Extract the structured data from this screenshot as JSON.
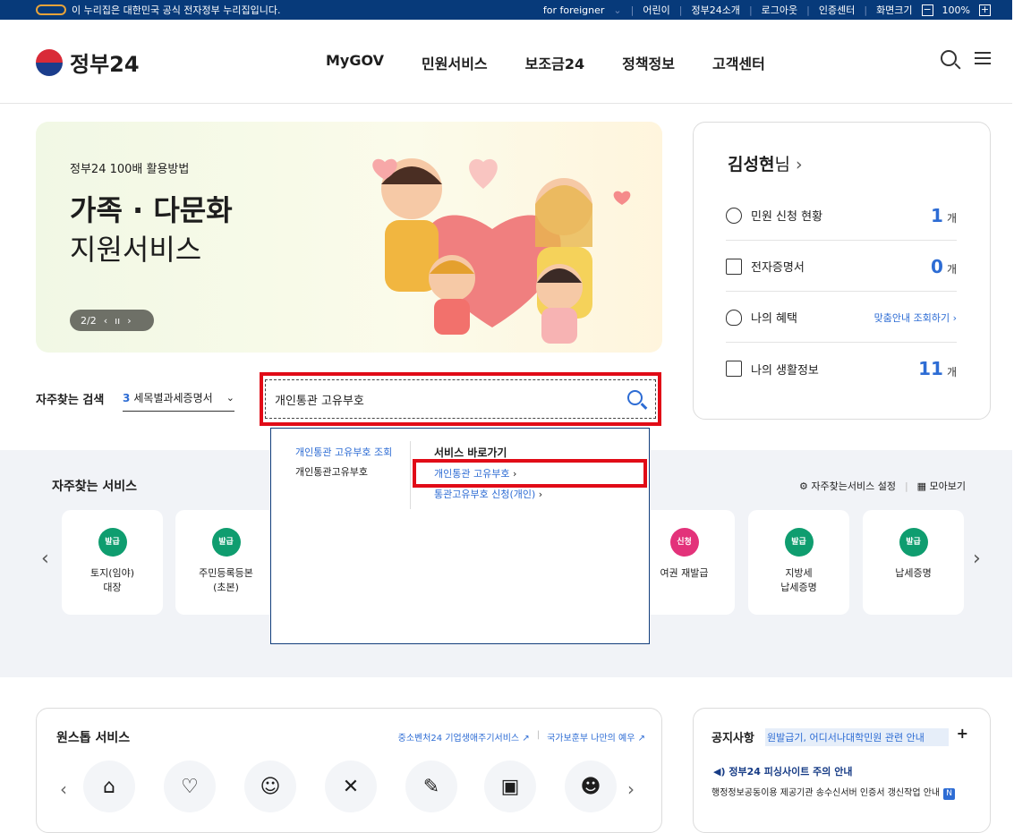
{
  "topbar": {
    "gov_notice": "이 누리집은 대한민국 공식 전자정부 누리집입니다.",
    "links": [
      "for foreigner",
      "어린이",
      "정부24소개",
      "로그아웃",
      "인증센터",
      "화면크기"
    ],
    "zoom": "100%",
    "zoom_minus": "−",
    "zoom_plus": "+"
  },
  "header": {
    "logo": "정부24",
    "nav": [
      "MyGOV",
      "민원서비스",
      "보조금24",
      "정책정보",
      "고객센터"
    ]
  },
  "banner": {
    "subtitle": "정부24 100배 활용방법",
    "title_line1": "가족 · 다문화",
    "title_line2": "지원서비스",
    "pager": "2/2"
  },
  "user": {
    "name": "김성현",
    "suffix": "님",
    "rows": [
      {
        "label": "민원 신청 현황",
        "count": "1",
        "unit": "개"
      },
      {
        "label": "전자증명서",
        "count": "0",
        "unit": "개"
      },
      {
        "label": "나의 혜택",
        "link": "맞춤안내 조회하기"
      },
      {
        "label": "나의 생활정보",
        "count": "11",
        "unit": "개"
      }
    ]
  },
  "search": {
    "label": "자주찾는 검색",
    "select_num": "3",
    "select_text": "세목별과세증명서",
    "query": "개인통관 고유부호"
  },
  "dropdown": {
    "suggest1": "개인통관 고유부호 조회",
    "suggest2": "개인통관고유부호",
    "shortcut_title": "서비스 바로가기",
    "shortcut1": "개인통관 고유부호",
    "shortcut2": "통관고유부호 신청(개인)"
  },
  "favorites": {
    "title": "자주찾는 서비스",
    "settings": "자주찾는서비스 설정",
    "view_all": "모아보기",
    "cards": [
      {
        "badge": "발급",
        "color": "#0f9d6f",
        "line1": "토지(임야)",
        "line2": "대장"
      },
      {
        "badge": "발급",
        "color": "#0f9d6f",
        "line1": "주민등록등본",
        "line2": "(초본)"
      },
      {
        "badge": "신청",
        "color": "#e3327a",
        "line1": "여권 재발급",
        "line2": ""
      },
      {
        "badge": "발급",
        "color": "#0f9d6f",
        "line1": "지방세",
        "line2": "납세증명"
      },
      {
        "badge": "발급",
        "color": "#0f9d6f",
        "line1": "납세증명",
        "line2": ""
      }
    ]
  },
  "onestop": {
    "title": "원스톱 서비스",
    "link1": "중소벤처24 기업생애주기서비스",
    "link2": "국가보훈부 나만의 예우"
  },
  "notice": {
    "title": "공지사항",
    "ticker": "원발급기, 어디서나대학민원 관련 안내",
    "item1": "정부24 피싱사이트 주의 안내",
    "item2": "행정정보공동이용 제공기관 송수신서버 인증서 갱신작업 안내",
    "new_badge": "N"
  }
}
